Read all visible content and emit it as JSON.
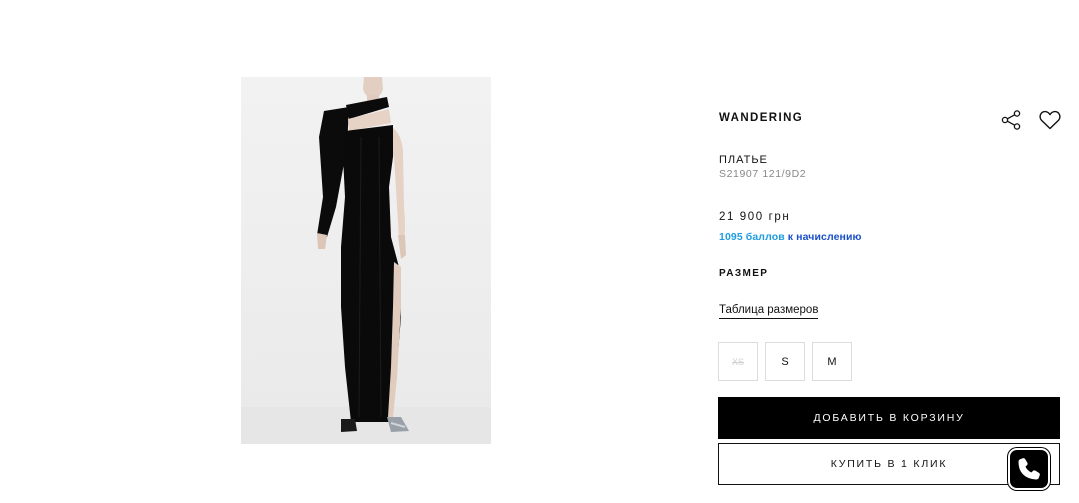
{
  "product": {
    "brand": "WANDERING",
    "category": "ПЛАТЬЕ",
    "article": "S21907 121/9D2",
    "price": "21 900 грн",
    "bonus_points": "1095 баллов",
    "bonus_suffix": " к начислению"
  },
  "sizes": {
    "heading": "РАЗМЕР",
    "table_link": "Таблица размеров",
    "options": [
      {
        "label": "XS",
        "available": false
      },
      {
        "label": "S",
        "available": true
      },
      {
        "label": "M",
        "available": true
      }
    ]
  },
  "actions": {
    "add_to_cart": "ДОБАВИТЬ В КОРЗИНУ",
    "buy_one_click": "КУПИТЬ В 1 КЛИК"
  },
  "icons": {
    "share": "share-icon",
    "wishlist": "heart-icon",
    "call": "phone-icon"
  },
  "colors": {
    "accent_blue": "#1e9de0",
    "bonus_text": "#1a4fc7",
    "primary_button": "#000000"
  }
}
